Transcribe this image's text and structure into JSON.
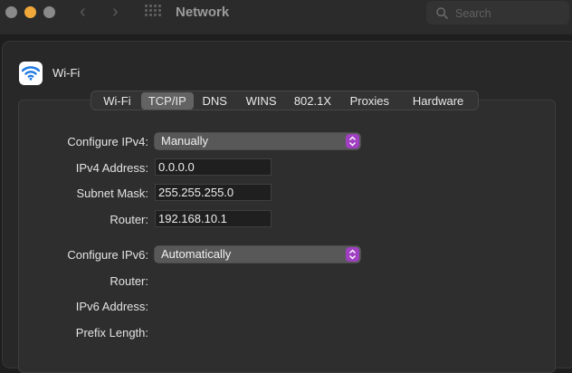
{
  "window": {
    "title": "Network"
  },
  "search": {
    "placeholder": "Search"
  },
  "service": {
    "name": "Wi-Fi",
    "icon": "wifi-icon"
  },
  "tabs": [
    {
      "label": "Wi-Fi",
      "active": false
    },
    {
      "label": "TCP/IP",
      "active": true
    },
    {
      "label": "DNS",
      "active": false
    },
    {
      "label": "WINS",
      "active": false
    },
    {
      "label": "802.1X",
      "active": false
    },
    {
      "label": "Proxies",
      "active": false
    },
    {
      "label": "Hardware",
      "active": false
    }
  ],
  "ipv4": {
    "configure_label": "Configure IPv4:",
    "configure_value": "Manually",
    "address_label": "IPv4 Address:",
    "address_value": "0.0.0.0",
    "subnet_label": "Subnet Mask:",
    "subnet_value": "255.255.255.0",
    "router_label": "Router:",
    "router_value": "192.168.10.1"
  },
  "ipv6": {
    "configure_label": "Configure IPv6:",
    "configure_value": "Automatically",
    "router_label": "Router:",
    "address_label": "IPv6 Address:",
    "prefix_label": "Prefix Length:"
  },
  "colors": {
    "accent": "#a03fc2",
    "minimize": "#f1a83b"
  }
}
